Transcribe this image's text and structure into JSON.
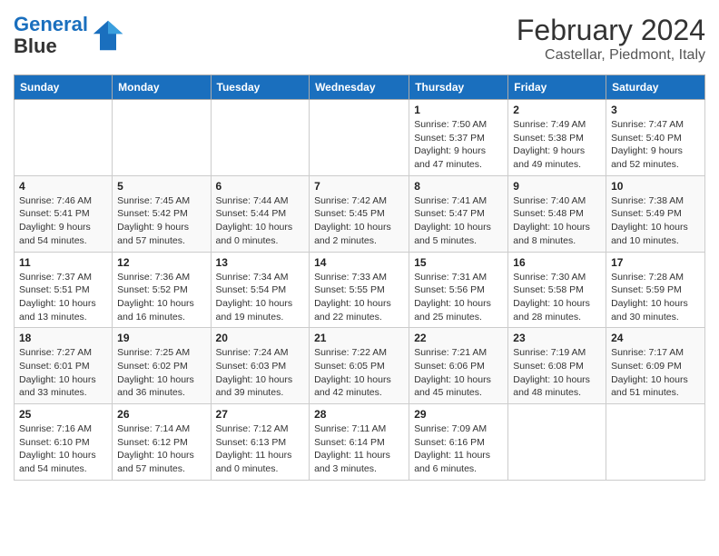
{
  "header": {
    "logo_line1": "General",
    "logo_line2": "Blue",
    "month_year": "February 2024",
    "location": "Castellar, Piedmont, Italy"
  },
  "days_of_week": [
    "Sunday",
    "Monday",
    "Tuesday",
    "Wednesday",
    "Thursday",
    "Friday",
    "Saturday"
  ],
  "weeks": [
    [
      {
        "num": "",
        "info": ""
      },
      {
        "num": "",
        "info": ""
      },
      {
        "num": "",
        "info": ""
      },
      {
        "num": "",
        "info": ""
      },
      {
        "num": "1",
        "info": "Sunrise: 7:50 AM\nSunset: 5:37 PM\nDaylight: 9 hours and 47 minutes."
      },
      {
        "num": "2",
        "info": "Sunrise: 7:49 AM\nSunset: 5:38 PM\nDaylight: 9 hours and 49 minutes."
      },
      {
        "num": "3",
        "info": "Sunrise: 7:47 AM\nSunset: 5:40 PM\nDaylight: 9 hours and 52 minutes."
      }
    ],
    [
      {
        "num": "4",
        "info": "Sunrise: 7:46 AM\nSunset: 5:41 PM\nDaylight: 9 hours and 54 minutes."
      },
      {
        "num": "5",
        "info": "Sunrise: 7:45 AM\nSunset: 5:42 PM\nDaylight: 9 hours and 57 minutes."
      },
      {
        "num": "6",
        "info": "Sunrise: 7:44 AM\nSunset: 5:44 PM\nDaylight: 10 hours and 0 minutes."
      },
      {
        "num": "7",
        "info": "Sunrise: 7:42 AM\nSunset: 5:45 PM\nDaylight: 10 hours and 2 minutes."
      },
      {
        "num": "8",
        "info": "Sunrise: 7:41 AM\nSunset: 5:47 PM\nDaylight: 10 hours and 5 minutes."
      },
      {
        "num": "9",
        "info": "Sunrise: 7:40 AM\nSunset: 5:48 PM\nDaylight: 10 hours and 8 minutes."
      },
      {
        "num": "10",
        "info": "Sunrise: 7:38 AM\nSunset: 5:49 PM\nDaylight: 10 hours and 10 minutes."
      }
    ],
    [
      {
        "num": "11",
        "info": "Sunrise: 7:37 AM\nSunset: 5:51 PM\nDaylight: 10 hours and 13 minutes."
      },
      {
        "num": "12",
        "info": "Sunrise: 7:36 AM\nSunset: 5:52 PM\nDaylight: 10 hours and 16 minutes."
      },
      {
        "num": "13",
        "info": "Sunrise: 7:34 AM\nSunset: 5:54 PM\nDaylight: 10 hours and 19 minutes."
      },
      {
        "num": "14",
        "info": "Sunrise: 7:33 AM\nSunset: 5:55 PM\nDaylight: 10 hours and 22 minutes."
      },
      {
        "num": "15",
        "info": "Sunrise: 7:31 AM\nSunset: 5:56 PM\nDaylight: 10 hours and 25 minutes."
      },
      {
        "num": "16",
        "info": "Sunrise: 7:30 AM\nSunset: 5:58 PM\nDaylight: 10 hours and 28 minutes."
      },
      {
        "num": "17",
        "info": "Sunrise: 7:28 AM\nSunset: 5:59 PM\nDaylight: 10 hours and 30 minutes."
      }
    ],
    [
      {
        "num": "18",
        "info": "Sunrise: 7:27 AM\nSunset: 6:01 PM\nDaylight: 10 hours and 33 minutes."
      },
      {
        "num": "19",
        "info": "Sunrise: 7:25 AM\nSunset: 6:02 PM\nDaylight: 10 hours and 36 minutes."
      },
      {
        "num": "20",
        "info": "Sunrise: 7:24 AM\nSunset: 6:03 PM\nDaylight: 10 hours and 39 minutes."
      },
      {
        "num": "21",
        "info": "Sunrise: 7:22 AM\nSunset: 6:05 PM\nDaylight: 10 hours and 42 minutes."
      },
      {
        "num": "22",
        "info": "Sunrise: 7:21 AM\nSunset: 6:06 PM\nDaylight: 10 hours and 45 minutes."
      },
      {
        "num": "23",
        "info": "Sunrise: 7:19 AM\nSunset: 6:08 PM\nDaylight: 10 hours and 48 minutes."
      },
      {
        "num": "24",
        "info": "Sunrise: 7:17 AM\nSunset: 6:09 PM\nDaylight: 10 hours and 51 minutes."
      }
    ],
    [
      {
        "num": "25",
        "info": "Sunrise: 7:16 AM\nSunset: 6:10 PM\nDaylight: 10 hours and 54 minutes."
      },
      {
        "num": "26",
        "info": "Sunrise: 7:14 AM\nSunset: 6:12 PM\nDaylight: 10 hours and 57 minutes."
      },
      {
        "num": "27",
        "info": "Sunrise: 7:12 AM\nSunset: 6:13 PM\nDaylight: 11 hours and 0 minutes."
      },
      {
        "num": "28",
        "info": "Sunrise: 7:11 AM\nSunset: 6:14 PM\nDaylight: 11 hours and 3 minutes."
      },
      {
        "num": "29",
        "info": "Sunrise: 7:09 AM\nSunset: 6:16 PM\nDaylight: 11 hours and 6 minutes."
      },
      {
        "num": "",
        "info": ""
      },
      {
        "num": "",
        "info": ""
      }
    ]
  ]
}
